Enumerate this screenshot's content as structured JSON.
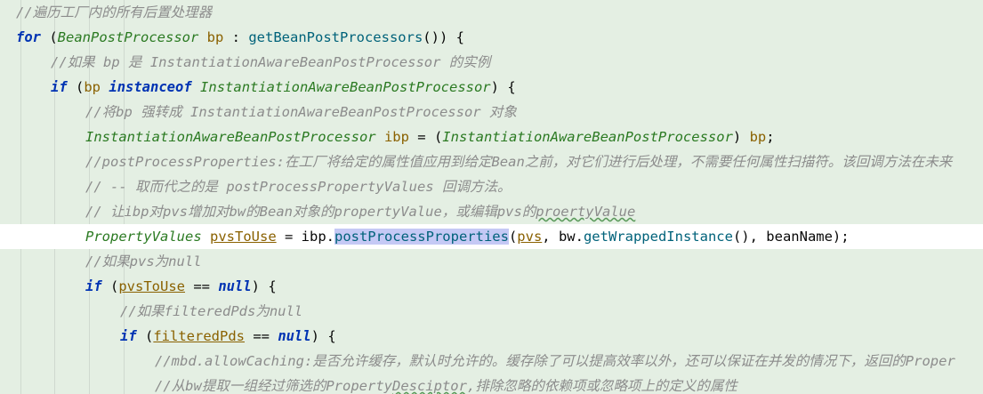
{
  "code": {
    "l1_comment": "//遍历工厂内的所有后置处理器",
    "l2_for": "for",
    "l2_open": " (",
    "l2_type": "BeanPostProcessor",
    "l2_sp": " ",
    "l2_var": "bp",
    "l2_colon": " : ",
    "l2_call": "getBeanPostProcessors",
    "l2_end": "()) {",
    "l3_comment": "//如果 bp 是 InstantiationAwareBeanPostProcessor 的实例",
    "l4_if": "if",
    "l4_open": " (",
    "l4_var": "bp",
    "l4_instanceof": "instanceof",
    "l4_type": "InstantiationAwareBeanPostProcessor",
    "l4_end": ") {",
    "l5_comment": "//将bp 强转成 InstantiationAwareBeanPostProcessor 对象",
    "l6_type": "InstantiationAwareBeanPostProcessor",
    "l6_var": "ibp",
    "l6_eq": " = (",
    "l6_cast": "InstantiationAwareBeanPostProcessor",
    "l6_close": ") ",
    "l6_bp": "bp",
    "l6_end": ";",
    "l7_comment": "//postProcessProperties:在工厂将给定的属性值应用到给定Bean之前，对它们进行后处理，不需要任何属性扫描符。该回调方法在未来",
    "l8_comment": "// -- 取而代之的是 postProcessPropertyValues 回调方法。",
    "l9_comment_a": "// 让ibp对pvs增加对bw的Bean对象的propertyValue，或编辑pvs的",
    "l9_comment_b": "proertyValue",
    "l10_type": "PropertyValues",
    "l10_var": "pvsToUse",
    "l10_eq": " = ",
    "l10_ibp": "ibp.",
    "l10_method": "postProcessProperties",
    "l10_open": "(",
    "l10_pvs": "pvs",
    "l10_mid": ", bw.",
    "l10_call2": "getWrappedInstance",
    "l10_end": "(), beanName);",
    "l11_comment": "//如果pvs为null",
    "l12_if": "if",
    "l12_open": " (",
    "l12_var": "pvsToUse",
    "l12_op": " == ",
    "l12_null": "null",
    "l12_end": ") {",
    "l13_comment": "//如果filteredPds为null",
    "l14_if": "if",
    "l14_open": " (",
    "l14_var": "filteredPds",
    "l14_op": " == ",
    "l14_null": "null",
    "l14_end": ") {",
    "l15_comment": "//mbd.allowCaching:是否允许缓存，默认时允许的。缓存除了可以提高效率以外，还可以保证在并发的情况下，返回的Proper",
    "l16_comment_a": "//从bw提取一组经过筛选的Property",
    "l16_comment_b": "Desciptor",
    "l16_comment_c": ",排除忽略的依赖项或忽略项上的定义的属性"
  }
}
